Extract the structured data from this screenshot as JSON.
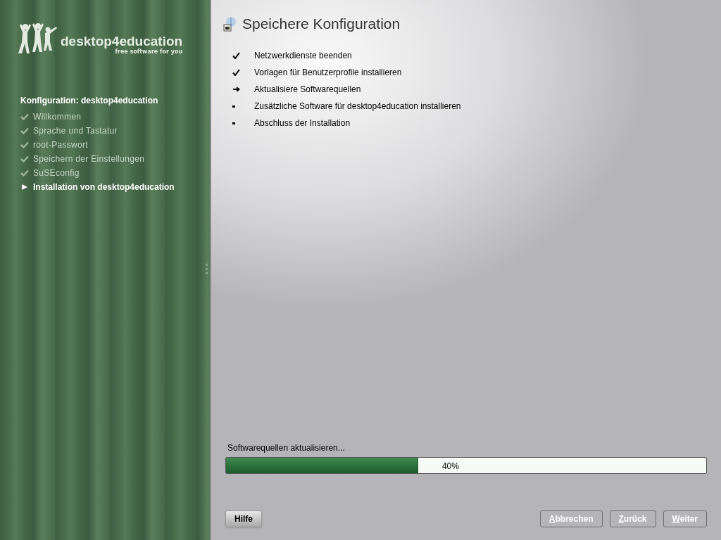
{
  "sidebar": {
    "logo": {
      "name": "desktop4education",
      "tagline": "free software for you"
    },
    "heading": "Konfiguration: desktop4education",
    "items": [
      {
        "label": "Willkommen",
        "kind": "done"
      },
      {
        "label": "Sprache und Tastatur",
        "kind": "done"
      },
      {
        "label": "root-Passwort",
        "kind": "done"
      },
      {
        "label": "Speichern der Einstellungen",
        "kind": "done"
      },
      {
        "label": "SuSEconfig",
        "kind": "done"
      },
      {
        "label": "Installation von desktop4education",
        "kind": "current"
      }
    ]
  },
  "main": {
    "title": "Speichere Konfiguration",
    "steps": [
      {
        "label": "Netzwerkdienste beenden",
        "kind": "done"
      },
      {
        "label": "Vorlagen für Benutzerprofile installieren",
        "kind": "done"
      },
      {
        "label": "Aktualisiere Softwarequellen",
        "kind": "current"
      },
      {
        "label": "Zusätzliche Software für desktop4education installieren",
        "kind": "pending"
      },
      {
        "label": "Abschluss der Installation",
        "kind": "pending"
      }
    ],
    "progress": {
      "label": "Softwarequellen aktualisieren...",
      "level": 0.4,
      "reading": "40%"
    }
  },
  "buttons": [
    {
      "label": "Hilfe",
      "disabled": false,
      "mnemonic": false
    },
    {
      "label": "Abbrechen",
      "disabled": true,
      "mnemonic": true
    },
    {
      "label": "Zurück",
      "disabled": true,
      "mnemonic": true
    },
    {
      "label": "Weiter",
      "disabled": true,
      "mnemonic": true
    }
  ]
}
